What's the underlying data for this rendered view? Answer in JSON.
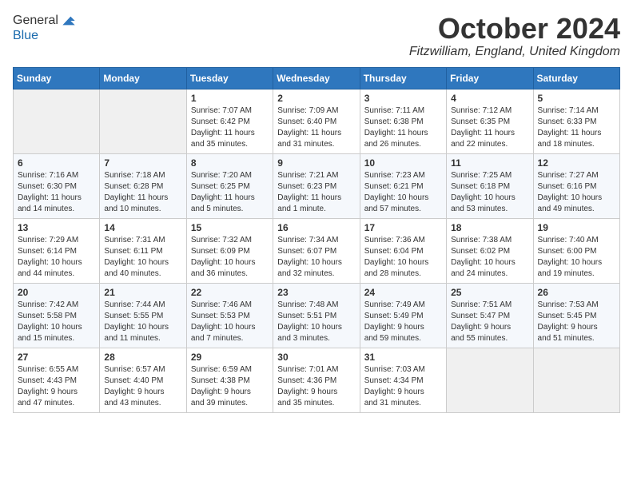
{
  "header": {
    "logo_line1": "General",
    "logo_line2": "Blue",
    "month_title": "October 2024",
    "location": "Fitzwilliam, England, United Kingdom"
  },
  "days_of_week": [
    "Sunday",
    "Monday",
    "Tuesday",
    "Wednesday",
    "Thursday",
    "Friday",
    "Saturday"
  ],
  "weeks": [
    [
      {
        "day": "",
        "content": ""
      },
      {
        "day": "",
        "content": ""
      },
      {
        "day": "1",
        "content": "Sunrise: 7:07 AM\nSunset: 6:42 PM\nDaylight: 11 hours\nand 35 minutes."
      },
      {
        "day": "2",
        "content": "Sunrise: 7:09 AM\nSunset: 6:40 PM\nDaylight: 11 hours\nand 31 minutes."
      },
      {
        "day": "3",
        "content": "Sunrise: 7:11 AM\nSunset: 6:38 PM\nDaylight: 11 hours\nand 26 minutes."
      },
      {
        "day": "4",
        "content": "Sunrise: 7:12 AM\nSunset: 6:35 PM\nDaylight: 11 hours\nand 22 minutes."
      },
      {
        "day": "5",
        "content": "Sunrise: 7:14 AM\nSunset: 6:33 PM\nDaylight: 11 hours\nand 18 minutes."
      }
    ],
    [
      {
        "day": "6",
        "content": "Sunrise: 7:16 AM\nSunset: 6:30 PM\nDaylight: 11 hours\nand 14 minutes."
      },
      {
        "day": "7",
        "content": "Sunrise: 7:18 AM\nSunset: 6:28 PM\nDaylight: 11 hours\nand 10 minutes."
      },
      {
        "day": "8",
        "content": "Sunrise: 7:20 AM\nSunset: 6:25 PM\nDaylight: 11 hours\nand 5 minutes."
      },
      {
        "day": "9",
        "content": "Sunrise: 7:21 AM\nSunset: 6:23 PM\nDaylight: 11 hours\nand 1 minute."
      },
      {
        "day": "10",
        "content": "Sunrise: 7:23 AM\nSunset: 6:21 PM\nDaylight: 10 hours\nand 57 minutes."
      },
      {
        "day": "11",
        "content": "Sunrise: 7:25 AM\nSunset: 6:18 PM\nDaylight: 10 hours\nand 53 minutes."
      },
      {
        "day": "12",
        "content": "Sunrise: 7:27 AM\nSunset: 6:16 PM\nDaylight: 10 hours\nand 49 minutes."
      }
    ],
    [
      {
        "day": "13",
        "content": "Sunrise: 7:29 AM\nSunset: 6:14 PM\nDaylight: 10 hours\nand 44 minutes."
      },
      {
        "day": "14",
        "content": "Sunrise: 7:31 AM\nSunset: 6:11 PM\nDaylight: 10 hours\nand 40 minutes."
      },
      {
        "day": "15",
        "content": "Sunrise: 7:32 AM\nSunset: 6:09 PM\nDaylight: 10 hours\nand 36 minutes."
      },
      {
        "day": "16",
        "content": "Sunrise: 7:34 AM\nSunset: 6:07 PM\nDaylight: 10 hours\nand 32 minutes."
      },
      {
        "day": "17",
        "content": "Sunrise: 7:36 AM\nSunset: 6:04 PM\nDaylight: 10 hours\nand 28 minutes."
      },
      {
        "day": "18",
        "content": "Sunrise: 7:38 AM\nSunset: 6:02 PM\nDaylight: 10 hours\nand 24 minutes."
      },
      {
        "day": "19",
        "content": "Sunrise: 7:40 AM\nSunset: 6:00 PM\nDaylight: 10 hours\nand 19 minutes."
      }
    ],
    [
      {
        "day": "20",
        "content": "Sunrise: 7:42 AM\nSunset: 5:58 PM\nDaylight: 10 hours\nand 15 minutes."
      },
      {
        "day": "21",
        "content": "Sunrise: 7:44 AM\nSunset: 5:55 PM\nDaylight: 10 hours\nand 11 minutes."
      },
      {
        "day": "22",
        "content": "Sunrise: 7:46 AM\nSunset: 5:53 PM\nDaylight: 10 hours\nand 7 minutes."
      },
      {
        "day": "23",
        "content": "Sunrise: 7:48 AM\nSunset: 5:51 PM\nDaylight: 10 hours\nand 3 minutes."
      },
      {
        "day": "24",
        "content": "Sunrise: 7:49 AM\nSunset: 5:49 PM\nDaylight: 9 hours\nand 59 minutes."
      },
      {
        "day": "25",
        "content": "Sunrise: 7:51 AM\nSunset: 5:47 PM\nDaylight: 9 hours\nand 55 minutes."
      },
      {
        "day": "26",
        "content": "Sunrise: 7:53 AM\nSunset: 5:45 PM\nDaylight: 9 hours\nand 51 minutes."
      }
    ],
    [
      {
        "day": "27",
        "content": "Sunrise: 6:55 AM\nSunset: 4:43 PM\nDaylight: 9 hours\nand 47 minutes."
      },
      {
        "day": "28",
        "content": "Sunrise: 6:57 AM\nSunset: 4:40 PM\nDaylight: 9 hours\nand 43 minutes."
      },
      {
        "day": "29",
        "content": "Sunrise: 6:59 AM\nSunset: 4:38 PM\nDaylight: 9 hours\nand 39 minutes."
      },
      {
        "day": "30",
        "content": "Sunrise: 7:01 AM\nSunset: 4:36 PM\nDaylight: 9 hours\nand 35 minutes."
      },
      {
        "day": "31",
        "content": "Sunrise: 7:03 AM\nSunset: 4:34 PM\nDaylight: 9 hours\nand 31 minutes."
      },
      {
        "day": "",
        "content": ""
      },
      {
        "day": "",
        "content": ""
      }
    ]
  ]
}
